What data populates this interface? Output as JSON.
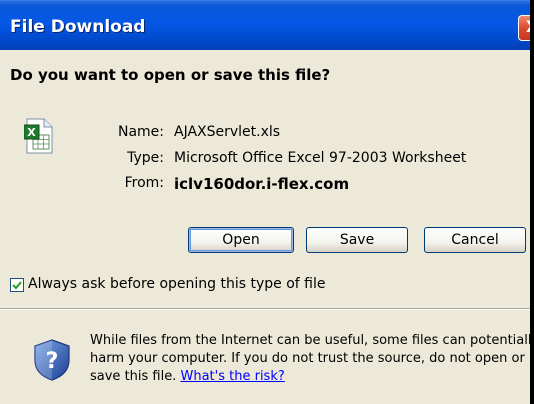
{
  "window": {
    "title": "File Download",
    "close_glyph": "X"
  },
  "question": "Do you want to open or save this file?",
  "file": {
    "icon": "excel-file-icon",
    "name_label": "Name:",
    "name_value": "AJAXServlet.xls",
    "type_label": "Type:",
    "type_value": "Microsoft Office Excel 97-2003 Worksheet",
    "from_label": "From:",
    "from_value": "iclv160dor.i-flex.com"
  },
  "buttons": {
    "open": "Open",
    "save": "Save",
    "cancel": "Cancel"
  },
  "checkbox": {
    "label": "Always ask before opening this type of file",
    "checked": true
  },
  "warning": {
    "icon": "shield-question-icon",
    "line1": "While files from the Internet can be useful, some files can potentially",
    "line2": "harm your computer. If you do not trust the source, do not open or",
    "line3_prefix": "save this file.",
    "link_text": "What's the risk?"
  },
  "colors": {
    "titlebar": "#0557e6",
    "dialog_bg": "#ece9d8",
    "link": "#0000ff",
    "close_button": "#d9482a"
  }
}
